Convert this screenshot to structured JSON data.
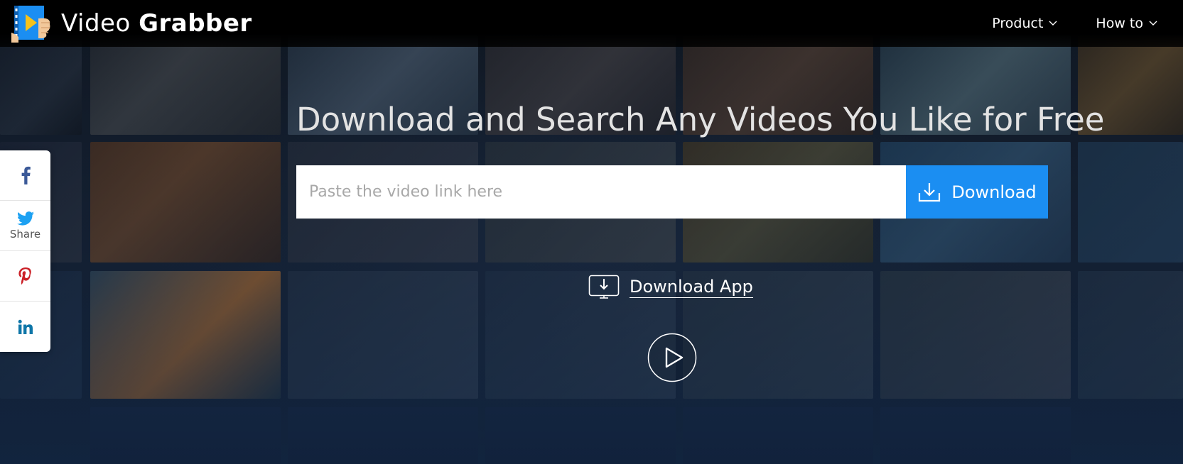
{
  "header": {
    "logo_text_light": "Video",
    "logo_text_bold": "Grabber",
    "nav": [
      {
        "label": "Product",
        "icon": "chevron-down-icon"
      },
      {
        "label": "How to",
        "icon": "chevron-down-icon"
      }
    ]
  },
  "hero": {
    "title": "Download and Search Any Videos You Like for Free",
    "search_placeholder": "Paste the video link here",
    "search_value": "",
    "download_button_label": "Download",
    "download_app_label": "Download App"
  },
  "share_bar": {
    "items": [
      {
        "icon": "facebook-icon",
        "label": ""
      },
      {
        "icon": "twitter-icon",
        "label": "Share"
      },
      {
        "icon": "pinterest-icon",
        "label": ""
      },
      {
        "icon": "linkedin-icon",
        "label": ""
      }
    ]
  },
  "colors": {
    "accent": "#1b8ef2",
    "facebook": "#3b5998",
    "twitter": "#1da1f2",
    "pinterest": "#cb2027",
    "linkedin": "#0e76a8",
    "topbar": "#000000"
  }
}
